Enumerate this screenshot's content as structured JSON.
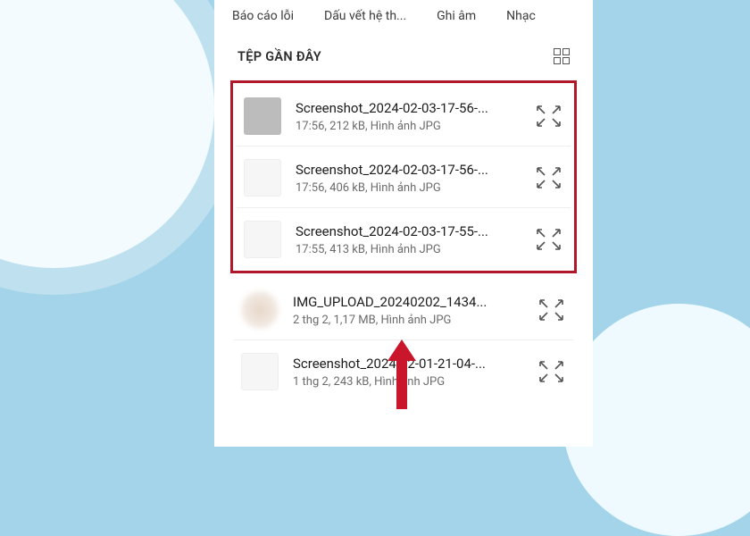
{
  "tabs": {
    "t0": "Báo cáo lỗi",
    "t1": "Dấu vết hệ th...",
    "t2": "Ghi âm",
    "t3": "Nhạc"
  },
  "section": {
    "title": "TỆP GẦN ĐÂY"
  },
  "files": {
    "f0": {
      "name": "Screenshot_2024-02-03-17-56-...",
      "meta": "17:56, 212 kB, Hình ảnh JPG"
    },
    "f1": {
      "name": "Screenshot_2024-02-03-17-56-...",
      "meta": "17:56, 406 kB, Hình ảnh JPG"
    },
    "f2": {
      "name": "Screenshot_2024-02-03-17-55-...",
      "meta": "17:55, 413 kB, Hình ảnh JPG"
    },
    "f3": {
      "name": "IMG_UPLOAD_20240202_1434...",
      "meta": "2 thg 2, 1,17 MB, Hình ảnh JPG"
    },
    "f4": {
      "name": "Screenshot_2024-02-01-21-04-...",
      "meta": "1 thg 2, 243 kB, Hình ảnh JPG"
    }
  }
}
